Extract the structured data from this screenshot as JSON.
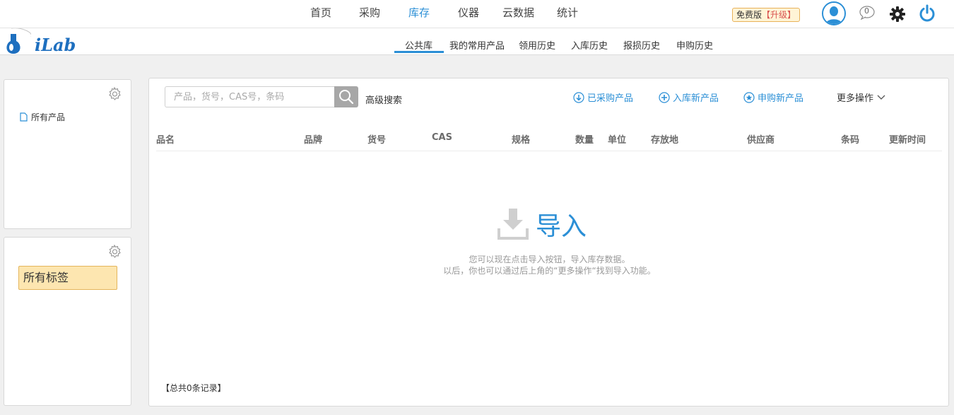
{
  "topnav": {
    "items": [
      {
        "label": "首页",
        "active": false
      },
      {
        "label": "采购",
        "active": false
      },
      {
        "label": "库存",
        "active": true
      },
      {
        "label": "仪器",
        "active": false
      },
      {
        "label": "云数据",
        "active": false
      },
      {
        "label": "统计",
        "active": false
      }
    ],
    "upgrade_label": "免费版",
    "upgrade_link": "【升级】",
    "message_count": "0"
  },
  "logo": {
    "text": "iLab"
  },
  "subnav": {
    "tabs": [
      {
        "label": "公共库",
        "active": true
      },
      {
        "label": "我的常用产品",
        "active": false
      },
      {
        "label": "领用历史",
        "active": false
      },
      {
        "label": "入库历史",
        "active": false
      },
      {
        "label": "报损历史",
        "active": false
      },
      {
        "label": "申购历史",
        "active": false
      }
    ]
  },
  "sidebar": {
    "all_products": "所有产品",
    "all_tags": "所有标签"
  },
  "search": {
    "placeholder": "产品，货号，CAS号，条码",
    "advanced": "高级搜索"
  },
  "actions": {
    "purchased": "已采购产品",
    "add_stock": "入库新产品",
    "request_new": "申购新产品",
    "more": "更多操作"
  },
  "table": {
    "columns": [
      "品名",
      "品牌",
      "货号",
      "CAS",
      "规格",
      "数量",
      "单位",
      "存放地",
      "供应商",
      "条码",
      "更新时间"
    ]
  },
  "empty_state": {
    "title": "导入",
    "hint1": "您可以现在点击导入按钮，导入库存数据。",
    "hint2": "以后，你也可以通过后上角的“更多操作“找到导入功能。"
  },
  "footer": {
    "total": "【总共0条记录】"
  },
  "colors": {
    "accent": "#2b8fd6",
    "tag_bg": "#fde6b0"
  }
}
